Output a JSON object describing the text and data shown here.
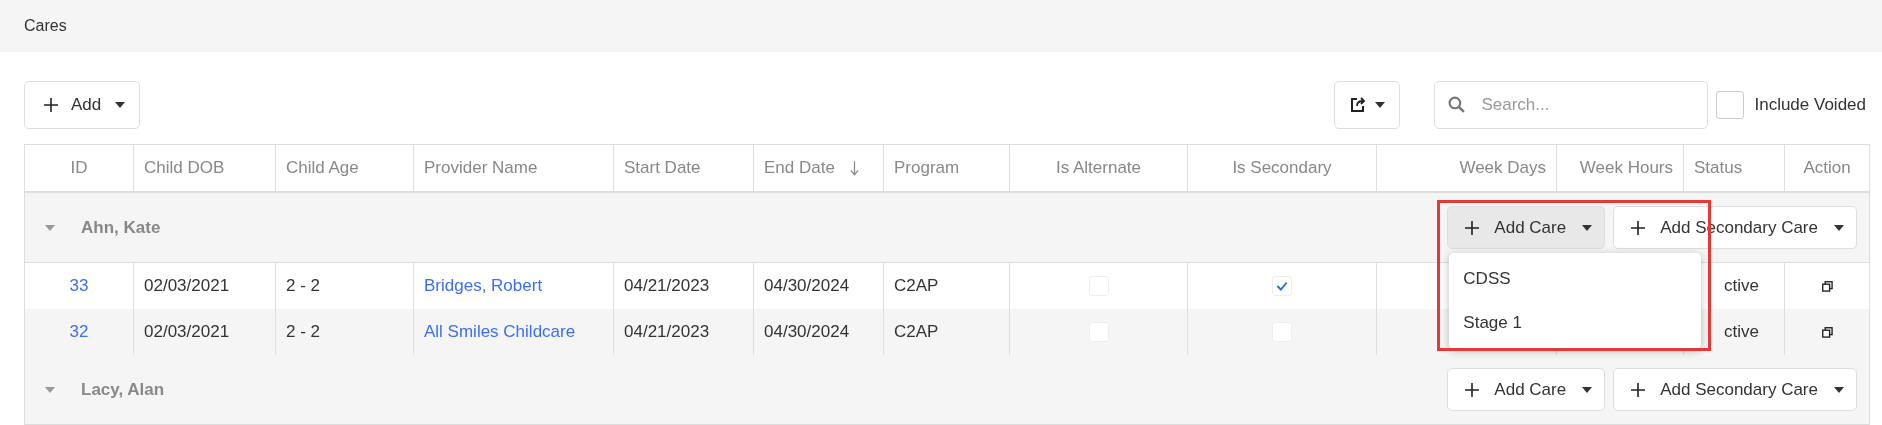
{
  "page_title": "Cares",
  "toolbar": {
    "add_button": "Add",
    "search": {
      "placeholder": "Search..."
    },
    "include_voided": {
      "label": "Include Voided",
      "checked": false
    }
  },
  "columns": [
    {
      "label": "ID",
      "sorted": false
    },
    {
      "label": "Child DOB",
      "sorted": false
    },
    {
      "label": "Child Age",
      "sorted": false
    },
    {
      "label": "Provider Name",
      "sorted": false
    },
    {
      "label": "Start Date",
      "sorted": false
    },
    {
      "label": "End Date",
      "sorted": true
    },
    {
      "label": "Program",
      "sorted": false
    },
    {
      "label": "Is Alternate",
      "sorted": false
    },
    {
      "label": "Is Secondary",
      "sorted": false
    },
    {
      "label": "Week Days",
      "sorted": false
    },
    {
      "label": "Week Hours",
      "sorted": false
    },
    {
      "label": "Status",
      "sorted": false
    },
    {
      "label": "Action",
      "sorted": false
    }
  ],
  "groups": [
    {
      "name": "Ahn, Kate",
      "expanded": true,
      "add_care": "Add Care",
      "add_secondary": "Add Secondary Care",
      "menu_open": true,
      "highlighted": true,
      "menu_items": [
        "CDSS",
        "Stage 1"
      ],
      "rows": [
        {
          "id": "33",
          "dob": "02/03/2021",
          "age": "2 - 2",
          "provider": "Bridges, Robert",
          "start": "04/21/2023",
          "end": "04/30/2024",
          "program": "C2AP",
          "is_alternate": false,
          "is_secondary": true,
          "status": "ctive"
        },
        {
          "id": "32",
          "dob": "02/03/2021",
          "age": "2 - 2",
          "provider": "All Smiles Childcare",
          "start": "04/21/2023",
          "end": "04/30/2024",
          "program": "C2AP",
          "is_alternate": false,
          "is_secondary": false,
          "status": "ctive"
        }
      ]
    },
    {
      "name": "Lacy, Alan",
      "expanded": true,
      "add_care": "Add Care",
      "add_secondary": "Add Secondary Care",
      "menu_open": false,
      "highlighted": false
    }
  ]
}
